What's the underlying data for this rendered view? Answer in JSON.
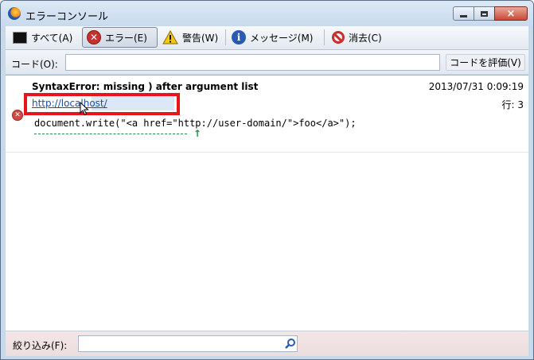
{
  "window": {
    "title": "エラーコンソール",
    "caption_close": "×"
  },
  "toolbar": {
    "all_label": "すべて(A)",
    "error_label": "エラー(E)",
    "error_glyph": "✕",
    "warning_label": "警告(W)",
    "message_label": "メッセージ(M)",
    "info_glyph": "i",
    "clear_label": "消去(C)"
  },
  "codebar": {
    "label": "コード(O):",
    "value": "",
    "evaluate_label": "コードを評価(V)"
  },
  "entries": [
    {
      "message": "SyntaxError: missing ) after argument list",
      "timestamp": "2013/07/31 0:09:19",
      "url": "http://localhost/",
      "line_label": "行:  3",
      "code": "document.write(\"<a href=\"http://user-domain/\">foo</a>\");",
      "caret": "↑",
      "icon_glyph": "✕"
    }
  ],
  "filterbar": {
    "label": "絞り込み(F):",
    "value": ""
  },
  "colors": {
    "highlight_box": "#e8141a",
    "link": "#1a4ea8",
    "error_icon": "#c8302c"
  }
}
